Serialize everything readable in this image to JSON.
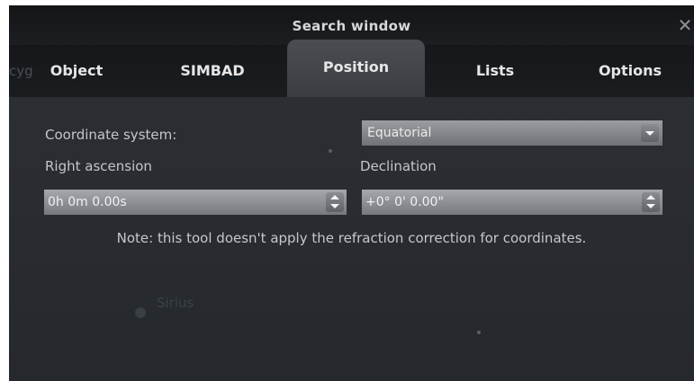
{
  "window": {
    "title": "Search window",
    "close_glyph": "✕"
  },
  "tabs": [
    {
      "label": "Object",
      "active": false
    },
    {
      "label": "SIMBAD",
      "active": false
    },
    {
      "label": "Position",
      "active": true
    },
    {
      "label": "Lists",
      "active": false
    },
    {
      "label": "Options",
      "active": false
    }
  ],
  "background": {
    "left_fragment": "cyg",
    "sky_label": "Sirius"
  },
  "position_panel": {
    "coordinate_system_label": "Coordinate system:",
    "coordinate_system_value": "Equatorial",
    "right_ascension_label": "Right ascension",
    "right_ascension_value": "0h 0m 0.00s",
    "declination_label": "Declination",
    "declination_value": "+0° 0' 0.00\"",
    "note": "Note: this tool doesn't apply the refraction correction for coordinates."
  },
  "icons": {
    "close": "close-icon",
    "combo_arrow": "chevron-down-icon",
    "spin": "spin-arrows-icon"
  },
  "colors": {
    "window_bg": "#2a2d31",
    "tab_active": "#44484d",
    "field_bg": "#8a8d91",
    "text": "#c6c8cb"
  }
}
